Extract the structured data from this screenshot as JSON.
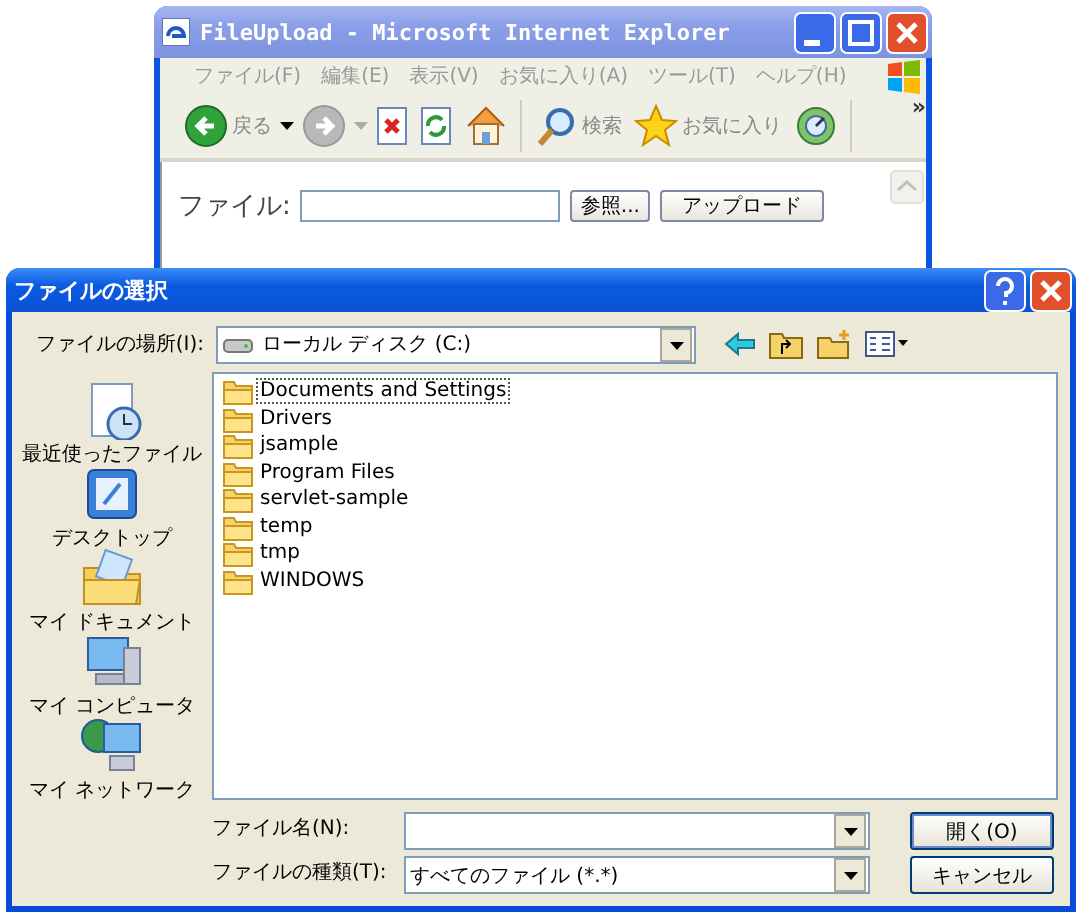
{
  "browser": {
    "title": "FileUpload - Microsoft Internet Explorer",
    "menu": [
      {
        "label": "ファイル(F)"
      },
      {
        "label": "編集(E)"
      },
      {
        "label": "表示(V)"
      },
      {
        "label": "お気に入り(A)"
      },
      {
        "label": "ツール(T)"
      },
      {
        "label": "ヘルプ(H)"
      }
    ],
    "toolbar": [
      {
        "kind": "back",
        "label": "戻る"
      },
      {
        "kind": "forward"
      },
      {
        "kind": "stop"
      },
      {
        "kind": "refresh"
      },
      {
        "kind": "home"
      },
      {
        "kind": "search",
        "label": "検索"
      },
      {
        "kind": "favorites",
        "label": "お気に入り"
      },
      {
        "kind": "media"
      }
    ],
    "chevron": "»",
    "page": {
      "label": "ファイル:",
      "browse": "参照...",
      "upload": "アップロード"
    }
  },
  "dialog": {
    "title": "ファイルの選択",
    "location_label": "ファイルの場所(I):",
    "location": "ローカル ディスク (C:)",
    "places": [
      {
        "kind": "recent",
        "label": "最近使ったファイル"
      },
      {
        "kind": "desktop",
        "label": "デスクトップ"
      },
      {
        "kind": "documents",
        "label": "マイ ドキュメント"
      },
      {
        "kind": "computer",
        "label": "マイ コンピュータ"
      },
      {
        "kind": "network",
        "label": "マイ ネットワーク"
      }
    ],
    "files": [
      {
        "name": "Documents and Settings",
        "focused": true
      },
      {
        "name": "Drivers",
        "focused": false
      },
      {
        "name": "jsample",
        "focused": false
      },
      {
        "name": "Program Files",
        "focused": false
      },
      {
        "name": "servlet-sample",
        "focused": false
      },
      {
        "name": "temp",
        "focused": false
      },
      {
        "name": "tmp",
        "focused": false
      },
      {
        "name": "WINDOWS",
        "focused": false
      }
    ],
    "filename_label": "ファイル名(N):",
    "filetype_label": "ファイルの種類(T):",
    "filetype": "すべてのファイル (*.*)",
    "open": "開く(O)",
    "cancel": "キャンセル"
  }
}
